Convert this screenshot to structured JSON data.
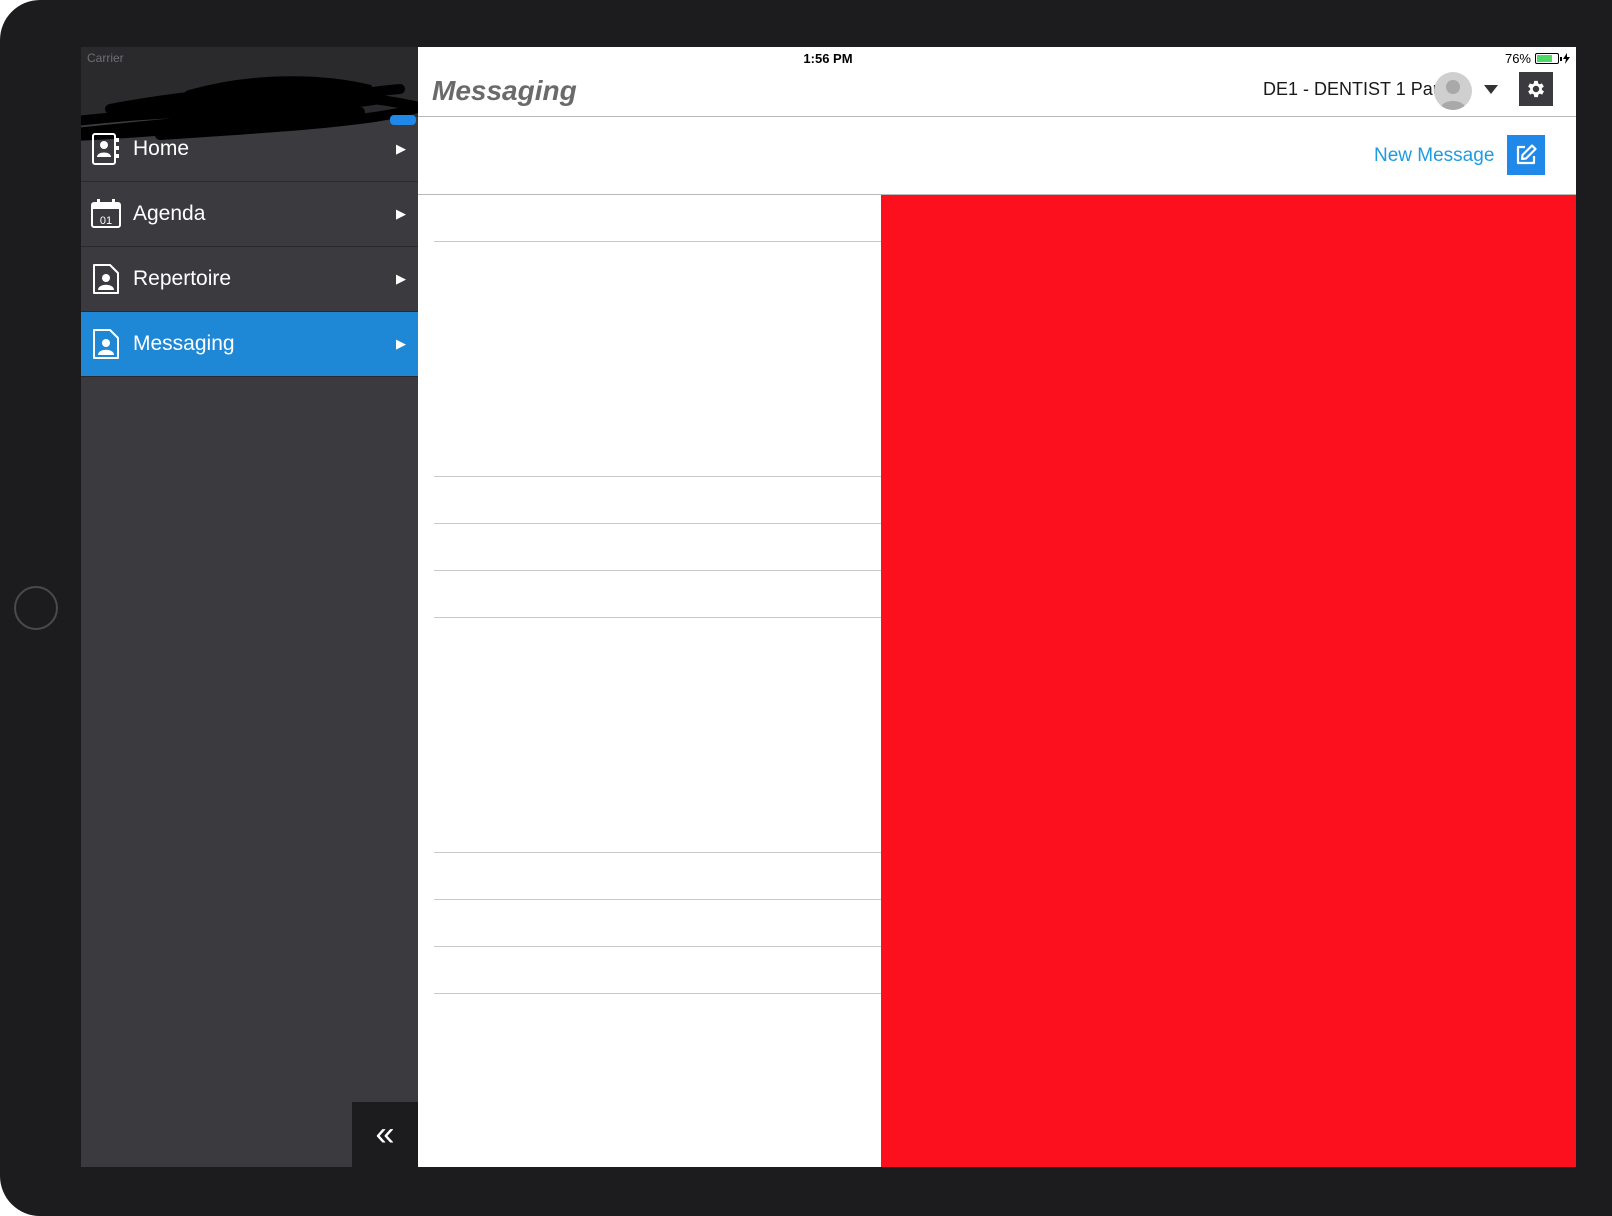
{
  "status_bar": {
    "carrier": "Carrier",
    "time": "1:56 PM",
    "battery_percent": "76%",
    "battery_level": 0.76
  },
  "sidebar": {
    "items": [
      {
        "label": "Home",
        "icon": "contact-book-icon"
      },
      {
        "label": "Agenda",
        "icon": "calendar-icon",
        "icon_text": "01"
      },
      {
        "label": "Repertoire",
        "icon": "contact-card-icon"
      },
      {
        "label": "Messaging",
        "icon": "contact-card-icon",
        "active": true
      }
    ],
    "arrow": "▶",
    "collapse": "«"
  },
  "header": {
    "title": "Messaging",
    "user": "DE1 - DENTIST 1 Paul"
  },
  "toolbar": {
    "new_message": "New Message"
  },
  "colors": {
    "accent": "#1f88d6",
    "link": "#1f9be0",
    "detail_background": "#fc101d",
    "sidebar": "#3b3b3f"
  }
}
